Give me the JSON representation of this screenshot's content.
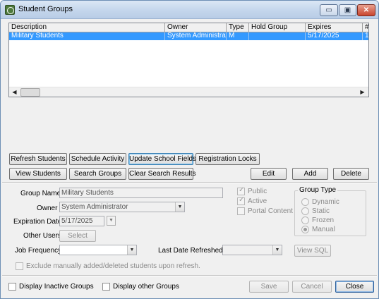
{
  "window": {
    "title": "Student Groups",
    "controls": {
      "minimize": "▭",
      "maximize": "▣",
      "close": "✕"
    }
  },
  "grid": {
    "columns": [
      "Description",
      "Owner",
      "Type",
      "Hold Group",
      "Expires",
      "#"
    ],
    "rows": [
      [
        "Military Students",
        "System Administrator",
        "M",
        "",
        "5/17/2025",
        "1"
      ]
    ]
  },
  "buttons": {
    "refresh_students": "Refresh Students",
    "schedule_activity": "Schedule Activity",
    "update_school_fields": "Update School Fields",
    "registration_locks": "Registration Locks",
    "view_students": "View Students",
    "search_groups": "Search Groups",
    "clear_search_results": "Clear Search Results",
    "edit": "Edit",
    "add": "Add",
    "delete": "Delete",
    "select": "Select",
    "view_sql": "View SQL",
    "save": "Save",
    "cancel": "Cancel",
    "close": "Close"
  },
  "form": {
    "group_name_label": "Group Name",
    "group_name_value": "Military Students",
    "owner_label": "Owner",
    "owner_value": "System Administrator",
    "expiration_label": "Expiration Date",
    "expiration_value": "5/17/2025",
    "other_users_label": "Other Users",
    "job_frequency_label": "Job Frequency",
    "job_frequency_value": "",
    "last_refreshed_label": "Last Date Refreshed",
    "last_refreshed_value": "",
    "public_label": "Public",
    "public_checked": true,
    "active_label": "Active",
    "active_checked": true,
    "portal_content_label": "Portal Content",
    "portal_content_checked": false,
    "exclude_label": "Exclude manually added/deleted students upon refresh.",
    "exclude_checked": false
  },
  "group_type": {
    "title": "Group Type",
    "options": [
      "Dynamic",
      "Static",
      "Frozen",
      "Manual"
    ],
    "selected": "Manual"
  },
  "footer": {
    "display_inactive_label": "Display Inactive Groups",
    "display_inactive_checked": false,
    "display_other_label": "Display other Groups",
    "display_other_checked": false
  },
  "colors": {
    "selection": "#3399ff",
    "accent": "#3c7fb1"
  },
  "icons": {
    "dropdown": "▼",
    "calendar": "▼",
    "scroll_left": "◀",
    "scroll_right": "▶"
  }
}
